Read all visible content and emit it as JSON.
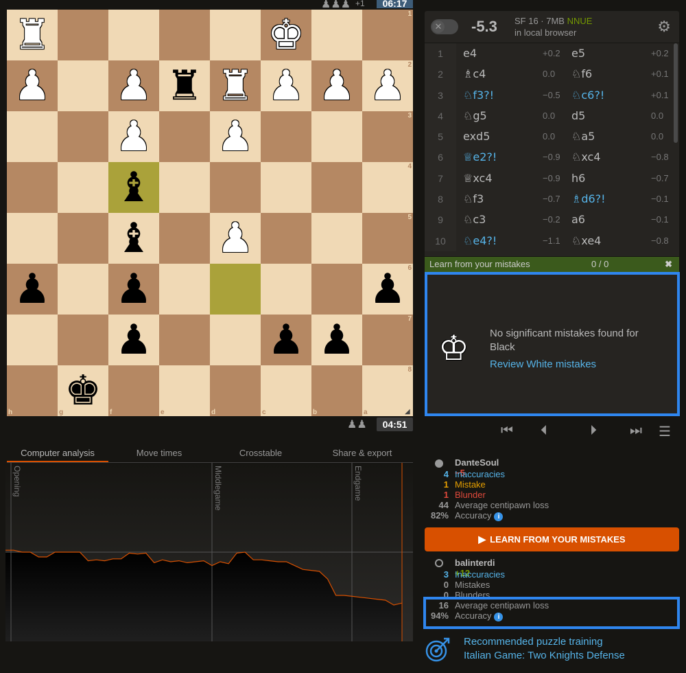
{
  "clocks": {
    "top": "06:17",
    "bottom": "04:51",
    "top_material": "+1"
  },
  "board": {
    "files_bottom": [
      "h",
      "g",
      "f",
      "e",
      "d",
      "c",
      "b",
      "a"
    ],
    "ranks_right": [
      "1",
      "2",
      "3",
      "4",
      "5",
      "6",
      "7",
      "8"
    ],
    "rows": [
      [
        "wR",
        "",
        "",
        "",
        "",
        "wK",
        "",
        ""
      ],
      [
        "wP",
        "",
        "wP",
        "bR",
        "wR",
        "wP",
        "wP",
        "wP"
      ],
      [
        "",
        "",
        "wP",
        "",
        "wP",
        "",
        "",
        ""
      ],
      [
        "",
        "",
        "bB",
        "",
        "",
        "",
        "",
        ""
      ],
      [
        "",
        "",
        "bB",
        "",
        "wP",
        "",
        "",
        ""
      ],
      [
        "bP",
        "",
        "bP",
        "",
        "",
        "",
        "",
        "bP"
      ],
      [
        "",
        "",
        "bP",
        "",
        "",
        "bP",
        "bP",
        ""
      ],
      [
        "",
        "bK",
        "",
        "",
        "",
        "",
        "",
        ""
      ]
    ],
    "highlights": [
      [
        3,
        2
      ],
      [
        5,
        4
      ]
    ],
    "colors": {
      "light": "#f0d9b5",
      "dark": "#b58863",
      "highlight": "#aaa23a"
    }
  },
  "tabs": [
    {
      "label": "Computer analysis",
      "active": true
    },
    {
      "label": "Move times",
      "active": false
    },
    {
      "label": "Crosstable",
      "active": false
    },
    {
      "label": "Share & export",
      "active": false
    }
  ],
  "graph": {
    "phases": [
      "Opening",
      "Middlegame",
      "Endgame"
    ],
    "advantage": [
      0.2,
      0.2,
      0.0,
      0.0,
      -0.5,
      -0.5,
      0.0,
      0.0,
      0.0,
      0.0,
      -0.9,
      -0.8,
      -0.9,
      -0.7,
      -0.7,
      -0.1,
      -0.2,
      -0.1,
      -1.1,
      -0.8,
      -1.0,
      -0.9,
      -1.1,
      -1.0,
      -0.9,
      -1.4,
      -1.0,
      -1.2,
      -0.1,
      0.0,
      -0.8,
      -0.8,
      -0.9,
      -1.0,
      -1.0,
      -1.4,
      -1.8,
      -1.9,
      -2.0,
      -2.8,
      -4.5,
      -4.5,
      -4.6,
      -4.7,
      -4.8,
      -4.9,
      -5.0,
      -5.5,
      -5.3
    ]
  },
  "engine": {
    "eval": "-5.3",
    "name": "SF 16 · 7MB",
    "nnue": "NNUE",
    "location": "in local browser"
  },
  "moves": [
    {
      "n": "1",
      "w": "e4",
      "we": "+0.2",
      "b": "e5",
      "be": "+0.2",
      "wi": false,
      "bi": false
    },
    {
      "n": "2",
      "w": "♗c4",
      "we": "0.0",
      "b": "♘f6",
      "be": "+0.1",
      "wi": false,
      "bi": false
    },
    {
      "n": "3",
      "w": "♘f3?!",
      "we": "−0.5",
      "b": "♘c6?!",
      "be": "+0.1",
      "wi": true,
      "bi": true
    },
    {
      "n": "4",
      "w": "♘g5",
      "we": "0.0",
      "b": "d5",
      "be": "0.0",
      "wi": false,
      "bi": false
    },
    {
      "n": "5",
      "w": "exd5",
      "we": "0.0",
      "b": "♘a5",
      "be": "0.0",
      "wi": false,
      "bi": false
    },
    {
      "n": "6",
      "w": "♕e2?!",
      "we": "−0.9",
      "b": "♘xc4",
      "be": "−0.8",
      "wi": true,
      "bi": false
    },
    {
      "n": "7",
      "w": "♕xc4",
      "we": "−0.9",
      "b": "h6",
      "be": "−0.7",
      "wi": false,
      "bi": false
    },
    {
      "n": "8",
      "w": "♘f3",
      "we": "−0.7",
      "b": "♗d6?!",
      "be": "−0.1",
      "wi": false,
      "bi": true
    },
    {
      "n": "9",
      "w": "♘c3",
      "we": "−0.2",
      "b": "a6",
      "be": "−0.1",
      "wi": false,
      "bi": false
    },
    {
      "n": "10",
      "w": "♘e4?!",
      "we": "−1.1",
      "b": "♘xe4",
      "be": "−0.8",
      "wi": true,
      "bi": false
    }
  ],
  "learn": {
    "title": "Learn from your mistakes",
    "count": "0 / 0",
    "message": "No significant mistakes found for Black",
    "review_link": "Review White mistakes"
  },
  "players": {
    "white": {
      "name": "DanteSoul",
      "diff": "−5",
      "stats": [
        {
          "num": "4",
          "label": "Inaccuracies",
          "kind": "inacc"
        },
        {
          "num": "1",
          "label": "Mistake",
          "kind": "mist"
        },
        {
          "num": "1",
          "label": "Blunder",
          "kind": "blun"
        },
        {
          "num": "44",
          "label": "Average centipawn loss",
          "kind": "grey"
        },
        {
          "num": "82%",
          "label": "Accuracy",
          "kind": "grey"
        }
      ]
    },
    "black": {
      "name": "balinterdi",
      "diff": "+12",
      "stats": [
        {
          "num": "3",
          "label": "Inaccuracies",
          "kind": "inacc"
        },
        {
          "num": "0",
          "label": "Mistakes",
          "kind": "grey"
        },
        {
          "num": "0",
          "label": "Blunders",
          "kind": "grey"
        },
        {
          "num": "16",
          "label": "Average centipawn loss",
          "kind": "grey"
        },
        {
          "num": "94%",
          "label": "Accuracy",
          "kind": "grey"
        }
      ]
    }
  },
  "learn_button": "LEARN FROM YOUR MISTAKES",
  "puzzle": {
    "title": "Recommended puzzle training",
    "opening": "Italian Game: Two Knights Defense"
  }
}
